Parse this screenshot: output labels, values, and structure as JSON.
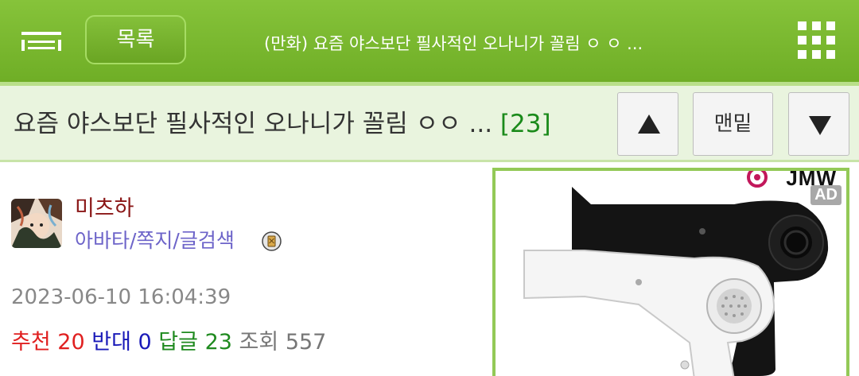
{
  "header": {
    "list_button": "목록",
    "title": "(만화) 요즘 야스보단 필사적인 오나니가 꼴림 ㅇ ㅇ ..."
  },
  "article": {
    "title": "요즘 야스보단 필사적인 오나니가 꼴림 ㅇㅇ ...",
    "comment_count": "[23]"
  },
  "nav": {
    "up_symbol": "▲",
    "bottom_label": "맨밑",
    "down_symbol": "▼"
  },
  "author": {
    "name": "미츠하",
    "links": "아바타/쪽지/글검색"
  },
  "post": {
    "date": "2023-06-10 16:04:39",
    "recommend_label": "추천",
    "recommend_count": "20",
    "oppose_label": "반대",
    "oppose_count": "0",
    "reply_label": "답글",
    "reply_count": "23",
    "views_label": "조회",
    "views_count": "557"
  },
  "ad": {
    "brand": "JMW",
    "label": "AD"
  },
  "colors": {
    "header_green": "#7ab82f",
    "title_bar_bg": "#e9f4de",
    "recommend": "#e02020",
    "oppose": "#1a1ab8",
    "reply": "#1f8a1f",
    "username": "#8a1616",
    "links": "#6d64c9"
  },
  "icons": [
    "menu-icon",
    "grid-menu-icon",
    "triangle-up-icon",
    "triangle-down-icon",
    "user-level-badge-icon"
  ]
}
